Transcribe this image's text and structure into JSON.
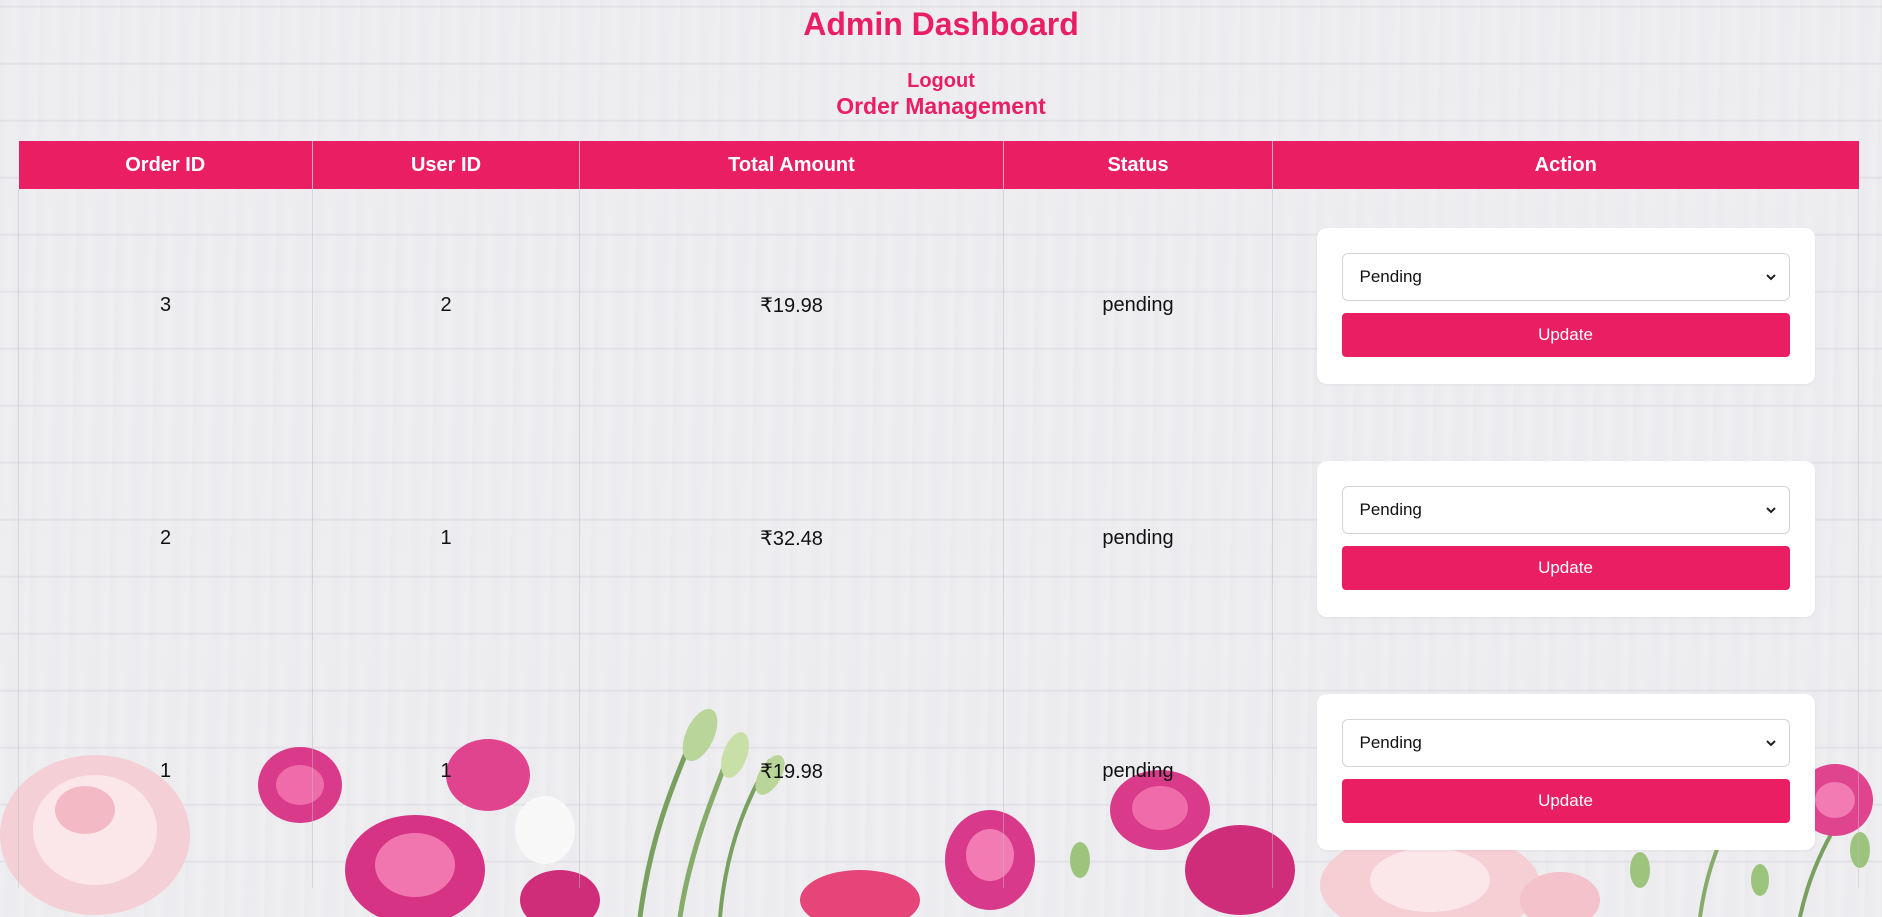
{
  "header": {
    "title": "Admin Dashboard",
    "logout_label": "Logout",
    "subtitle": "Order Management"
  },
  "table": {
    "columns": [
      "Order ID",
      "User ID",
      "Total Amount",
      "Status",
      "Action"
    ],
    "rows": [
      {
        "order_id": "3",
        "user_id": "2",
        "total": "₹19.98",
        "status": "pending",
        "select_value": "Pending",
        "button_label": "Update"
      },
      {
        "order_id": "2",
        "user_id": "1",
        "total": "₹32.48",
        "status": "pending",
        "select_value": "Pending",
        "button_label": "Update"
      },
      {
        "order_id": "1",
        "user_id": "1",
        "total": "₹19.98",
        "status": "pending",
        "select_value": "Pending",
        "button_label": "Update"
      }
    ]
  },
  "icons": {
    "dropdown": "chevron-down-icon",
    "background": "roses-decoration"
  },
  "colors": {
    "accent": "#e91e63",
    "background": "#eeeef1",
    "card": "#ffffff"
  }
}
